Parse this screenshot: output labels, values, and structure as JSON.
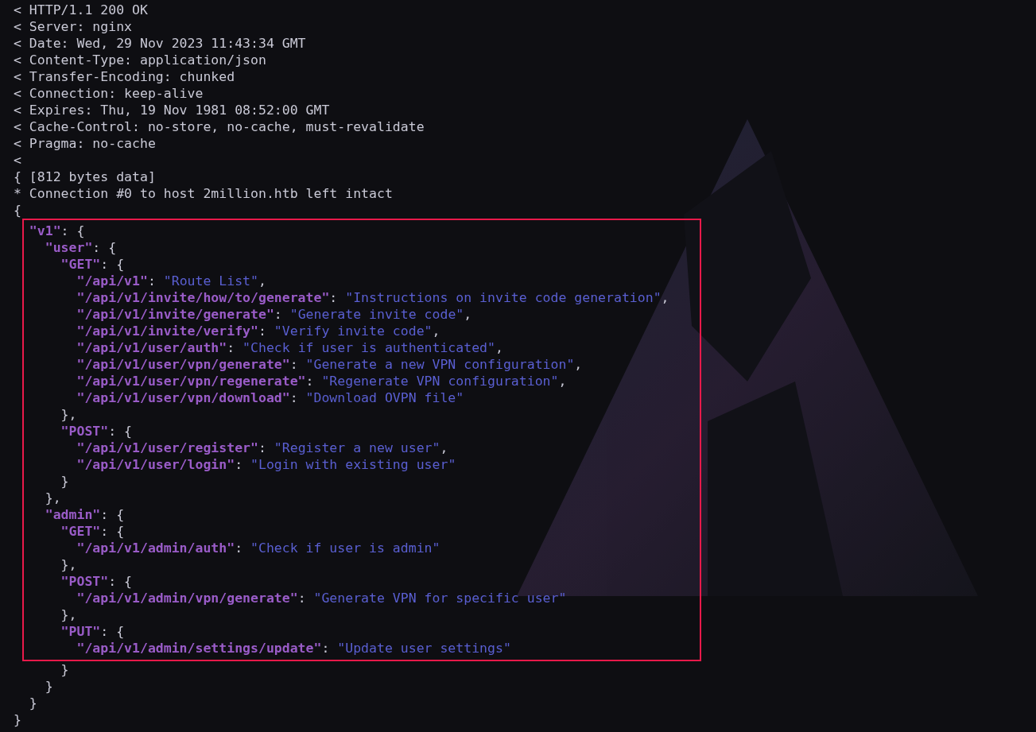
{
  "terminal": {
    "lines_before": [
      {
        "tokens": [
          {
            "kind": "text",
            "text": "< HTTP/1.1 200 OK"
          }
        ]
      },
      {
        "tokens": [
          {
            "kind": "text",
            "text": "< Server: nginx"
          }
        ]
      },
      {
        "tokens": [
          {
            "kind": "text",
            "text": "< Date: Wed, 29 Nov 2023 11:43:34 GMT"
          }
        ]
      },
      {
        "tokens": [
          {
            "kind": "text",
            "text": "< Content-Type: application/json"
          }
        ]
      },
      {
        "tokens": [
          {
            "kind": "text",
            "text": "< Transfer-Encoding: chunked"
          }
        ]
      },
      {
        "tokens": [
          {
            "kind": "text",
            "text": "< Connection: keep-alive"
          }
        ]
      },
      {
        "tokens": [
          {
            "kind": "text",
            "text": "< Expires: Thu, 19 Nov 1981 08:52:00 GMT"
          }
        ]
      },
      {
        "tokens": [
          {
            "kind": "text",
            "text": "< Cache-Control: no-store, no-cache, must-revalidate"
          }
        ]
      },
      {
        "tokens": [
          {
            "kind": "text",
            "text": "< Pragma: no-cache"
          }
        ]
      },
      {
        "tokens": [
          {
            "kind": "text",
            "text": "<"
          }
        ]
      },
      {
        "tokens": [
          {
            "kind": "text",
            "text": "{ [812 bytes data]"
          }
        ]
      },
      {
        "tokens": [
          {
            "kind": "text",
            "text": "* Connection #0 to host 2million.htb left intact"
          }
        ]
      },
      {
        "tokens": [
          {
            "kind": "text",
            "text": "{"
          }
        ]
      }
    ],
    "highlighted_lines": [
      {
        "tokens": [
          {
            "kind": "key",
            "text": "  \"v1\""
          },
          {
            "kind": "text",
            "text": ": {"
          }
        ]
      },
      {
        "tokens": [
          {
            "kind": "key",
            "text": "    \"user\""
          },
          {
            "kind": "text",
            "text": ": {"
          }
        ]
      },
      {
        "tokens": [
          {
            "kind": "key",
            "text": "      \"GET\""
          },
          {
            "kind": "text",
            "text": ": {"
          }
        ]
      },
      {
        "tokens": [
          {
            "kind": "key",
            "text": "        \"/api/v1\""
          },
          {
            "kind": "text",
            "text": ": "
          },
          {
            "kind": "string",
            "text": "\"Route List\""
          },
          {
            "kind": "text",
            "text": ","
          }
        ]
      },
      {
        "tokens": [
          {
            "kind": "key",
            "text": "        \"/api/v1/invite/how/to/generate\""
          },
          {
            "kind": "text",
            "text": ": "
          },
          {
            "kind": "string",
            "text": "\"Instructions on invite code generation\""
          },
          {
            "kind": "text",
            "text": ","
          }
        ]
      },
      {
        "tokens": [
          {
            "kind": "key",
            "text": "        \"/api/v1/invite/generate\""
          },
          {
            "kind": "text",
            "text": ": "
          },
          {
            "kind": "string",
            "text": "\"Generate invite code\""
          },
          {
            "kind": "text",
            "text": ","
          }
        ]
      },
      {
        "tokens": [
          {
            "kind": "key",
            "text": "        \"/api/v1/invite/verify\""
          },
          {
            "kind": "text",
            "text": ": "
          },
          {
            "kind": "string",
            "text": "\"Verify invite code\""
          },
          {
            "kind": "text",
            "text": ","
          }
        ]
      },
      {
        "tokens": [
          {
            "kind": "key",
            "text": "        \"/api/v1/user/auth\""
          },
          {
            "kind": "text",
            "text": ": "
          },
          {
            "kind": "string",
            "text": "\"Check if user is authenticated\""
          },
          {
            "kind": "text",
            "text": ","
          }
        ]
      },
      {
        "tokens": [
          {
            "kind": "key",
            "text": "        \"/api/v1/user/vpn/generate\""
          },
          {
            "kind": "text",
            "text": ": "
          },
          {
            "kind": "string",
            "text": "\"Generate a new VPN configuration\""
          },
          {
            "kind": "text",
            "text": ","
          }
        ]
      },
      {
        "tokens": [
          {
            "kind": "key",
            "text": "        \"/api/v1/user/vpn/regenerate\""
          },
          {
            "kind": "text",
            "text": ": "
          },
          {
            "kind": "string",
            "text": "\"Regenerate VPN configuration\""
          },
          {
            "kind": "text",
            "text": ","
          }
        ]
      },
      {
        "tokens": [
          {
            "kind": "key",
            "text": "        \"/api/v1/user/vpn/download\""
          },
          {
            "kind": "text",
            "text": ": "
          },
          {
            "kind": "string",
            "text": "\"Download OVPN file\""
          }
        ]
      },
      {
        "tokens": [
          {
            "kind": "text",
            "text": "      },"
          }
        ]
      },
      {
        "tokens": [
          {
            "kind": "key",
            "text": "      \"POST\""
          },
          {
            "kind": "text",
            "text": ": {"
          }
        ]
      },
      {
        "tokens": [
          {
            "kind": "key",
            "text": "        \"/api/v1/user/register\""
          },
          {
            "kind": "text",
            "text": ": "
          },
          {
            "kind": "string",
            "text": "\"Register a new user\""
          },
          {
            "kind": "text",
            "text": ","
          }
        ]
      },
      {
        "tokens": [
          {
            "kind": "key",
            "text": "        \"/api/v1/user/login\""
          },
          {
            "kind": "text",
            "text": ": "
          },
          {
            "kind": "string",
            "text": "\"Login with existing user\""
          }
        ]
      },
      {
        "tokens": [
          {
            "kind": "text",
            "text": "      }"
          }
        ]
      },
      {
        "tokens": [
          {
            "kind": "text",
            "text": "    },"
          }
        ]
      },
      {
        "tokens": [
          {
            "kind": "key",
            "text": "    \"admin\""
          },
          {
            "kind": "text",
            "text": ": {"
          }
        ]
      },
      {
        "tokens": [
          {
            "kind": "key",
            "text": "      \"GET\""
          },
          {
            "kind": "text",
            "text": ": {"
          }
        ]
      },
      {
        "tokens": [
          {
            "kind": "key",
            "text": "        \"/api/v1/admin/auth\""
          },
          {
            "kind": "text",
            "text": ": "
          },
          {
            "kind": "string",
            "text": "\"Check if user is admin\""
          }
        ]
      },
      {
        "tokens": [
          {
            "kind": "text",
            "text": "      },"
          }
        ]
      },
      {
        "tokens": [
          {
            "kind": "key",
            "text": "      \"POST\""
          },
          {
            "kind": "text",
            "text": ": {"
          }
        ]
      },
      {
        "tokens": [
          {
            "kind": "key",
            "text": "        \"/api/v1/admin/vpn/generate\""
          },
          {
            "kind": "text",
            "text": ": "
          },
          {
            "kind": "string",
            "text": "\"Generate VPN for specific user\""
          }
        ]
      },
      {
        "tokens": [
          {
            "kind": "text",
            "text": "      },"
          }
        ]
      },
      {
        "tokens": [
          {
            "kind": "key",
            "text": "      \"PUT\""
          },
          {
            "kind": "text",
            "text": ": {"
          }
        ]
      },
      {
        "tokens": [
          {
            "kind": "key",
            "text": "        \"/api/v1/admin/settings/update\""
          },
          {
            "kind": "text",
            "text": ": "
          },
          {
            "kind": "string",
            "text": "\"Update user settings\""
          }
        ]
      }
    ],
    "lines_after": [
      {
        "tokens": [
          {
            "kind": "text",
            "text": "      }"
          }
        ]
      },
      {
        "tokens": [
          {
            "kind": "text",
            "text": "    }"
          }
        ]
      },
      {
        "tokens": [
          {
            "kind": "text",
            "text": "  }"
          }
        ]
      },
      {
        "tokens": [
          {
            "kind": "text",
            "text": "}"
          }
        ]
      }
    ]
  }
}
